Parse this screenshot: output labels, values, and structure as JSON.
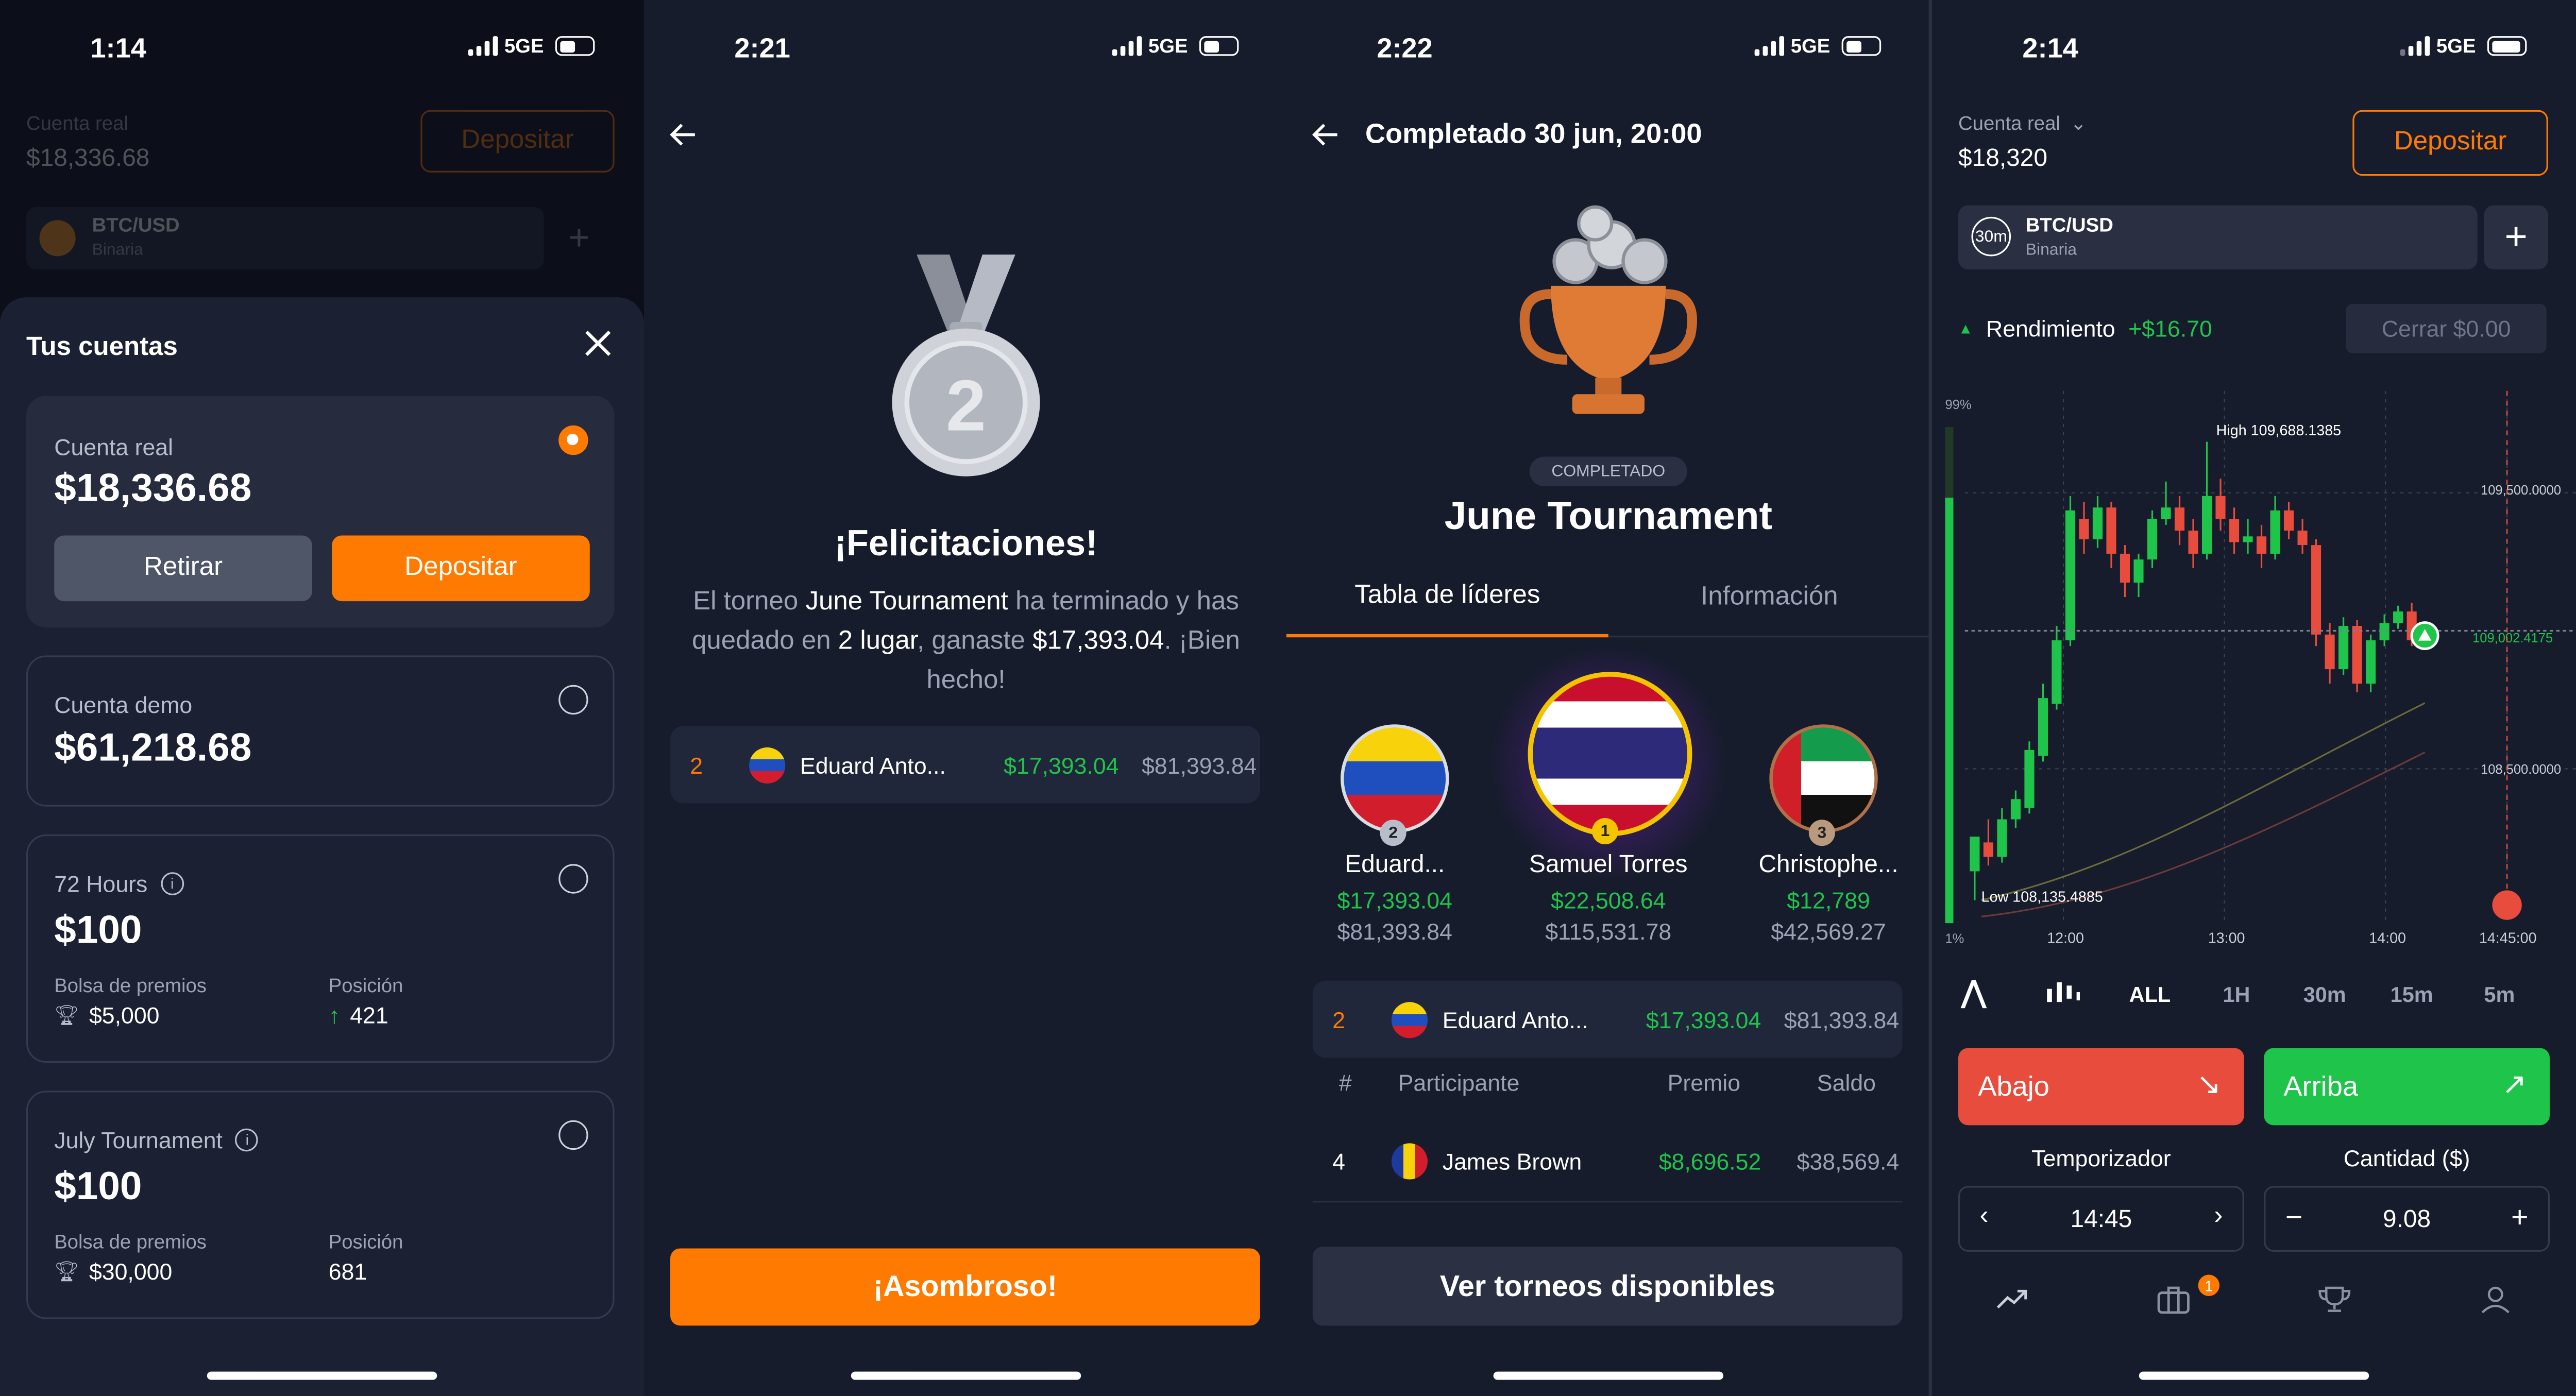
{
  "colors": {
    "accent": "#ff7a00",
    "green": "#1fc44a",
    "red": "#e74c3c",
    "bg": "#171c2d"
  },
  "p1": {
    "time": "1:14",
    "net": "5GE",
    "bg_account_label": "Cuenta real",
    "bg_balance": "$18,336.68",
    "bg_deposit": "Depositar",
    "bg_pair": "BTC/USD",
    "bg_type": "Binaria",
    "sheet_title": "Tus cuentas",
    "real": {
      "label": "Cuenta real",
      "balance": "$18,336.68",
      "withdraw": "Retirar",
      "deposit": "Depositar"
    },
    "demo": {
      "label": "Cuenta demo",
      "balance": "$61,218.68"
    },
    "t72": {
      "label": "72 Hours",
      "balance": "$100",
      "prize_label": "Bolsa de premios",
      "prize": "$5,000",
      "pos_label": "Posición",
      "pos": "421"
    },
    "july": {
      "label": "July Tournament",
      "balance": "$100",
      "prize_label": "Bolsa de premios",
      "prize": "$30,000",
      "pos_label": "Posición",
      "pos": "681"
    }
  },
  "p2": {
    "time": "2:21",
    "net": "5GE",
    "medal_number": "2",
    "title": "¡Felicitaciones!",
    "msg_a": "El torneo ",
    "msg_name": "June Tournament",
    "msg_b": " ha terminado y has quedado en ",
    "msg_place": "2 lugar",
    "msg_c": ", ganaste ",
    "msg_amount": "$17,393.04",
    "msg_d": ". ¡Bien hecho!",
    "row": {
      "rank": "2",
      "name": "Eduard Anto...",
      "win": "$17,393.04",
      "bal": "$81,393.84"
    },
    "cta": "¡Asombroso!"
  },
  "p3": {
    "time": "2:22",
    "net": "5GE",
    "header": "Completado 30 jun, 20:00",
    "badge": "COMPLETADO",
    "title": "June Tournament",
    "tab_leaders": "Tabla de líderes",
    "tab_info": "Información",
    "podium": [
      {
        "rank": "2",
        "name": "Eduard...",
        "win": "$17,393.04",
        "bal": "$81,393.84"
      },
      {
        "rank": "1",
        "name": "Samuel Torres",
        "win": "$22,508.64",
        "bal": "$115,531.78"
      },
      {
        "rank": "3",
        "name": "Christophe...",
        "win": "$12,789",
        "bal": "$42,569.27"
      }
    ],
    "me": {
      "rank": "2",
      "name": "Eduard Anto...",
      "win": "$17,393.04",
      "bal": "$81,393.84"
    },
    "cols": {
      "num": "#",
      "participant": "Participante",
      "prize": "Premio",
      "balance": "Saldo"
    },
    "row4": {
      "rank": "4",
      "name": "James Brown",
      "win": "$8,696.52",
      "bal": "$38,569.4"
    },
    "cta": "Ver torneos disponibles"
  },
  "p4": {
    "time": "2:14",
    "net": "5GE",
    "account_label": "Cuenta real",
    "balance": "$18,320",
    "deposit": "Depositar",
    "timeframe": "30m",
    "pair": "BTC/USD",
    "pair_type": "Binaria",
    "perf_label": "Rendimiento",
    "perf_value": "+$16.70",
    "close_label": "Cerrar $0.00",
    "pct_top": "99%",
    "pct_bottom": "1%",
    "high_label": "High 109,688.1385",
    "low_label": "Low 108,135.4885",
    "price_top": "109,500.0000",
    "price_mid": "109,002.4175",
    "price_bottom": "108,500.0000",
    "times": [
      "12:00",
      "13:00",
      "14:00",
      "14:45:00"
    ],
    "ranges": [
      "ALL",
      "1H",
      "30m",
      "15m",
      "5m"
    ],
    "down": "Abajo",
    "up": "Arriba",
    "timer_label": "Temporizador",
    "timer_value": "14:45",
    "amount_label": "Cantidad ($)",
    "amount_value": "9.08",
    "badge_count": "1"
  },
  "chart_data": {
    "type": "candlestick",
    "title": "BTC/USD",
    "x_ticks": [
      "12:00",
      "13:00",
      "14:00",
      "14:45:00"
    ],
    "y_ticks": [
      109500,
      108500
    ],
    "current_price": 109002.4175,
    "high": 109688.1385,
    "low": 108135.4885,
    "ylim": [
      108100,
      109750
    ],
    "candles": [
      [
        108200,
        108320,
        108150,
        108100
      ],
      [
        108300,
        108250,
        108380,
        108220
      ],
      [
        108250,
        108380,
        108420,
        108230
      ],
      [
        108380,
        108450,
        108480,
        108350
      ],
      [
        108420,
        108620,
        108650,
        108400
      ],
      [
        108600,
        108800,
        108850,
        108580
      ],
      [
        108780,
        109000,
        109050,
        108760
      ],
      [
        109000,
        109450,
        109500,
        108980
      ],
      [
        109420,
        109350,
        109480,
        109300
      ],
      [
        109350,
        109460,
        109500,
        109320
      ],
      [
        109460,
        109300,
        109480,
        109250
      ],
      [
        109300,
        109200,
        109330,
        109150
      ],
      [
        109200,
        109280,
        109300,
        109150
      ],
      [
        109280,
        109420,
        109450,
        109250
      ],
      [
        109420,
        109460,
        109550,
        109400
      ],
      [
        109460,
        109380,
        109500,
        109330
      ],
      [
        109380,
        109300,
        109420,
        109250
      ],
      [
        109300,
        109500,
        109688,
        109280
      ],
      [
        109500,
        109420,
        109560,
        109380
      ],
      [
        109420,
        109340,
        109460,
        109300
      ],
      [
        109340,
        109360,
        109420,
        109300
      ],
      [
        109360,
        109300,
        109400,
        109250
      ],
      [
        109300,
        109450,
        109500,
        109280
      ],
      [
        109450,
        109380,
        109480,
        109350
      ],
      [
        109380,
        109330,
        109420,
        109300
      ],
      [
        109330,
        109020,
        109350,
        108980
      ],
      [
        109020,
        108900,
        109060,
        108850
      ],
      [
        108900,
        109050,
        109080,
        108880
      ],
      [
        109050,
        108850,
        109070,
        108820
      ],
      [
        108850,
        109000,
        109020,
        108820
      ],
      [
        109000,
        109060,
        109090,
        108980
      ],
      [
        109060,
        109100,
        109120,
        109040
      ],
      [
        109100,
        109000,
        109130,
        108980
      ]
    ]
  }
}
